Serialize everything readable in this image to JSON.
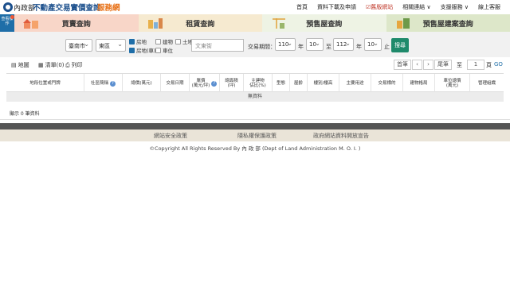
{
  "header": {
    "logo_part1": "內政部",
    "logo_part2": "不動產交易實價查詢",
    "logo_part3": "服務網",
    "nav": [
      {
        "label": "首頁"
      },
      {
        "label": "資料下載及申請"
      },
      {
        "label": "☑舊版網站"
      },
      {
        "label": "相關連結 ∨"
      },
      {
        "label": "支援服務 ∨"
      },
      {
        "label": "線上客服"
      }
    ]
  },
  "side_button": {
    "label": "查看操作"
  },
  "tabs": [
    {
      "label": "買賣查詢"
    },
    {
      "label": "租賃查詢"
    },
    {
      "label": "預售屋查詢"
    },
    {
      "label": "預售屋建案查詢"
    }
  ],
  "filters": {
    "city": "臺南市",
    "district": "東區",
    "type_options": [
      {
        "label": "房地",
        "checked": true
      },
      {
        "label": "建物",
        "checked": false
      },
      {
        "label": "土地",
        "checked": false
      },
      {
        "label": "房地(車)",
        "checked": true
      },
      {
        "label": "車位",
        "checked": false
      }
    ],
    "road_placeholder": "文東街",
    "period_label": "交易期間：",
    "start_year": "110",
    "start_month": "10",
    "end_year": "112",
    "end_month": "10",
    "year_unit": "年",
    "month_to": "至",
    "month_end": "止",
    "search_label": "搜尋"
  },
  "toolbar": {
    "map": "地圖",
    "list": "清單(0)",
    "print": "列印",
    "first": "首筆",
    "prev": "‹",
    "next": "›",
    "last": "尾筆",
    "goto_label": "至",
    "page_value": "1",
    "page_unit": "頁",
    "go": "GO"
  },
  "table": {
    "columns": [
      "地段位置或門牌",
      "社區簡稱",
      "總價(萬元)",
      "交易日期",
      "單價\n(萬元/坪)",
      "總面積\n(坪)",
      "主建物\n佔比(%)",
      "型態",
      "屋齡",
      "樓別/樓高",
      "主要用途",
      "交易標的",
      "建物格局",
      "車位總價\n(萬元)",
      "管理組織"
    ],
    "empty": "無資料"
  },
  "total_text": "顯示 0 筆資料",
  "footer": {
    "links": [
      "網站安全政策",
      "隱私權保護政策",
      "政府網站資料開放宣告"
    ],
    "copyright": "©Copyright All Rights Reserved By 內 政 部 (Dept of Land Administration M. O. I. )"
  }
}
